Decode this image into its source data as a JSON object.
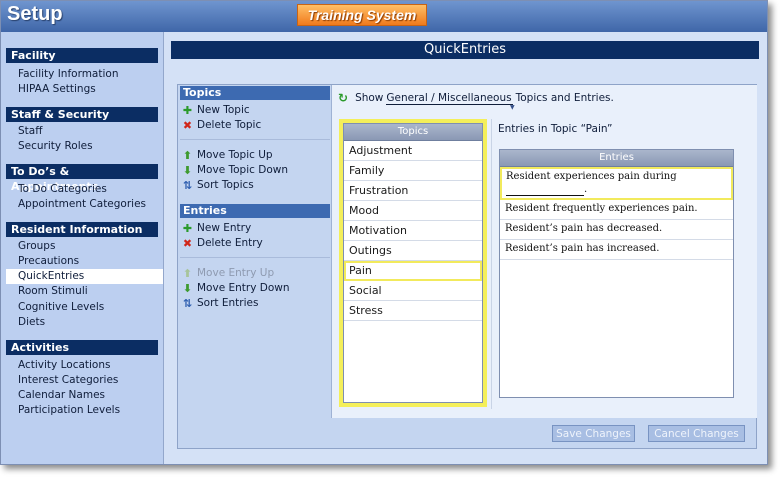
{
  "app": {
    "title": "Setup",
    "brand": "Training System"
  },
  "sidebar": {
    "sections": [
      {
        "title": "Facility",
        "items": [
          "Facility Information",
          "HIPAA Settings"
        ]
      },
      {
        "title": "Staff & Security",
        "items": [
          "Staff",
          "Security Roles"
        ]
      },
      {
        "title": "To Do’s & Appointments",
        "items": [
          "To Do Categories",
          "Appointment Categories"
        ]
      },
      {
        "title": "Resident Information",
        "items": [
          "Groups",
          "Precautions",
          "QuickEntries",
          "Room Stimuli",
          "Cognitive Levels",
          "Diets"
        ]
      },
      {
        "title": "Activities",
        "items": [
          "Activity Locations",
          "Interest Categories",
          "Calendar Names",
          "Participation Levels"
        ]
      }
    ],
    "active_item": "QuickEntries"
  },
  "main": {
    "title": "QuickEntries"
  },
  "actions": {
    "topics_header": "Topics",
    "new_topic": "New Topic",
    "delete_topic": "Delete Topic",
    "move_topic_up": "Move Topic Up",
    "move_topic_down": "Move Topic Down",
    "sort_topics": "Sort Topics",
    "entries_header": "Entries",
    "new_entry": "New Entry",
    "delete_entry": "Delete Entry",
    "move_entry_up": "Move Entry Up",
    "move_entry_down": "Move Entry Down",
    "sort_entries": "Sort Entries"
  },
  "filter": {
    "prefix": "Show",
    "selected": "General / Miscellaneous",
    "suffix": "Topics and Entries."
  },
  "topics": {
    "header": "Topics",
    "items": [
      "Adjustment",
      "Family",
      "Frustration",
      "Mood",
      "Motivation",
      "Outings",
      "Pain",
      "Social",
      "Stress"
    ],
    "selected": "Pain"
  },
  "entries": {
    "caption": "Entries in Topic “Pain”",
    "header": "Entries",
    "items": [
      "Resident experiences pain during",
      "Resident frequently experiences pain.",
      "Resident’s pain has decreased.",
      "Resident’s pain has increased."
    ]
  },
  "buttons": {
    "save": "Save Changes",
    "cancel": "Cancel Changes"
  },
  "colors": {
    "nav_header": "#0b2d63",
    "action_header": "#3d6ab1",
    "highlight": "#f4ef5a",
    "brand": "#f07a1c"
  }
}
